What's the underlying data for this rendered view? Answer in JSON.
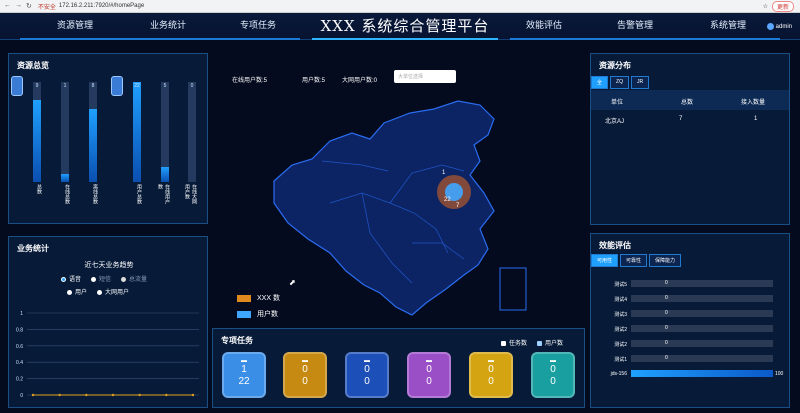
{
  "browser": {
    "security": "不安全",
    "url": "172.16.2.211:7920/#/homePage",
    "update": "更新"
  },
  "header": {
    "title": "XXX 系统综合管理平台",
    "menu": [
      "资源管理",
      "业务统计",
      "专项任务",
      "效能评估",
      "告警管理",
      "系统管理"
    ],
    "user": "admin"
  },
  "resource_overview": {
    "title": "资源总览",
    "bars": [
      {
        "label": "总数",
        "value": "9",
        "fraction": 0.82
      },
      {
        "label": "在线总数",
        "value": "1",
        "fraction": 0.08
      },
      {
        "label": "离线总数",
        "value": "8",
        "fraction": 0.73
      },
      {
        "label": "用户总数",
        "value": "22",
        "fraction": 1.0
      },
      {
        "label": "在线用户数",
        "value": "5",
        "fraction": 0.15
      },
      {
        "label": "在线大网用户数",
        "value": "0",
        "fraction": 0.0
      }
    ]
  },
  "business_stats": {
    "title": "业务统计",
    "chart_title": "近七天业务趋势",
    "legend_row1": [
      "语音",
      "短信",
      "总流量"
    ],
    "legend_row2": [
      "用户",
      "大网用户"
    ],
    "colors": {
      "voice": "#1fa0ff",
      "sms": "#ffffff",
      "total": "#e0e0e0"
    }
  },
  "chart_data": {
    "type": "line",
    "title": "近七天业务趋势",
    "x": [
      "1",
      "2",
      "3",
      "4",
      "5",
      "6",
      "7"
    ],
    "ylim": [
      0,
      1
    ],
    "yticks": [
      "0",
      "0.2",
      "0.4",
      "0.6",
      "0.8",
      "1"
    ],
    "series": [
      {
        "name": "语音",
        "values": [
          0,
          0,
          0,
          0,
          0,
          0,
          0
        ]
      }
    ]
  },
  "map": {
    "stats": [
      {
        "label": "在线用户数:",
        "value": "5"
      },
      {
        "label": "用户数:",
        "value": "5"
      },
      {
        "label": "大网用户数:",
        "value": "0"
      }
    ],
    "select_placeholder": "大单位选择",
    "marker_top": "1",
    "marker_value": "22",
    "marker_sub": "7",
    "legend": [
      {
        "label": "XXX 数",
        "color": "#e08a1e"
      },
      {
        "label": "用户数",
        "color": "#3ea6ff"
      }
    ]
  },
  "special_tasks": {
    "title": "专项任务",
    "legend": [
      "任务数",
      "用户数"
    ],
    "cards": [
      {
        "a": "1",
        "b": "22",
        "color": "#3a8ee6"
      },
      {
        "a": "0",
        "b": "0",
        "color": "#c68a12"
      },
      {
        "a": "0",
        "b": "0",
        "color": "#1d4fb8"
      },
      {
        "a": "0",
        "b": "0",
        "color": "#9a4fc7"
      },
      {
        "a": "0",
        "b": "0",
        "color": "#d4a413"
      },
      {
        "a": "0",
        "b": "0",
        "color": "#1a9fa0"
      }
    ]
  },
  "resource_dist": {
    "title": "资源分布",
    "tabs": [
      "全",
      "ZQ",
      "JR"
    ],
    "headers": [
      "单位",
      "总数",
      "接入数量"
    ],
    "rows": [
      {
        "unit": "北京AJ",
        "total": "7",
        "access": "1"
      }
    ]
  },
  "efficiency": {
    "title": "效能评估",
    "tabs": [
      "可用性",
      "可靠性",
      "保障能力"
    ],
    "rows": [
      {
        "name": "测试5",
        "value": "0",
        "fraction": 0
      },
      {
        "name": "测试4",
        "value": "0",
        "fraction": 0
      },
      {
        "name": "测试3",
        "value": "0",
        "fraction": 0
      },
      {
        "name": "测试2",
        "value": "0",
        "fraction": 0
      },
      {
        "name": "测试2",
        "value": "0",
        "fraction": 0
      },
      {
        "name": "测试1",
        "value": "0",
        "fraction": 0
      },
      {
        "name": "jds-156",
        "value": "100",
        "fraction": 1
      }
    ]
  }
}
